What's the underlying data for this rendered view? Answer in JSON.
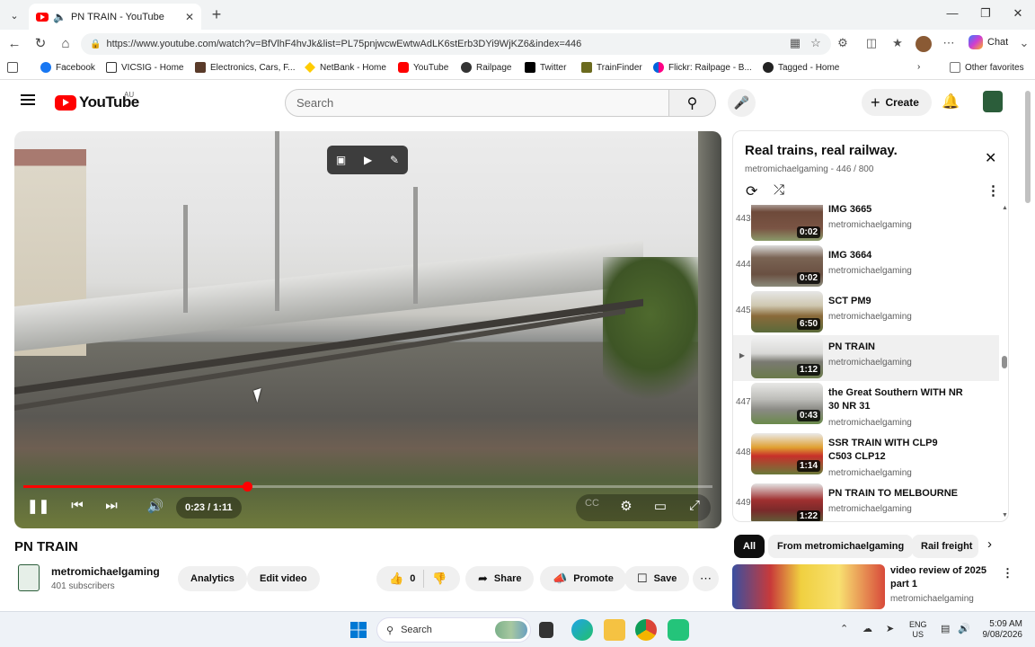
{
  "browser": {
    "tab_title": "PN TRAIN - YouTube",
    "url": "https://www.youtube.com/watch?v=BfVlhF4hvJk&list=PL75pnjwcwEwtwAdLK6stErb3DYi9WjKZ6&index=446",
    "chat_label": "Chat",
    "bookmarks": [
      "Facebook",
      "VICSIG - Home",
      "Electronics, Cars, F...",
      "NetBank - Home",
      "YouTube",
      "Railpage",
      "Twitter",
      "TrainFinder",
      "Flickr: Railpage - B...",
      "Tagged - Home"
    ],
    "other_favorites": "Other favorites"
  },
  "youtube": {
    "logo_text": "YouTube",
    "country_code": "AU",
    "search_placeholder": "Search",
    "create_label": "Create"
  },
  "player": {
    "current_time": "0:23",
    "duration": "1:11",
    "time_display": "0:23 / 1:11",
    "progress_fraction": 0.324
  },
  "video": {
    "title": "PN TRAIN",
    "channel": "metromichaelgaming",
    "subscribers": "401 subscribers",
    "analytics_label": "Analytics",
    "edit_label": "Edit video",
    "like_count": "0",
    "share_label": "Share",
    "promote_label": "Promote",
    "save_label": "Save"
  },
  "playlist": {
    "title": "Real trains, real railway.",
    "owner": "metromichaelgaming",
    "position": "446 / 800",
    "items": [
      {
        "index": "443",
        "title": "IMG 3665",
        "channel": "metromichaelgaming",
        "duration": "0:02"
      },
      {
        "index": "444",
        "title": "IMG 3664",
        "channel": "metromichaelgaming",
        "duration": "0:02"
      },
      {
        "index": "445",
        "title": "SCT PM9",
        "channel": "metromichaelgaming",
        "duration": "6:50"
      },
      {
        "index": "▶",
        "title": "PN TRAIN",
        "channel": "metromichaelgaming",
        "duration": "1:12"
      },
      {
        "index": "447",
        "title": "the Great Southern WITH NR 30 NR 31",
        "channel": "metromichaelgaming",
        "duration": "0:43"
      },
      {
        "index": "448",
        "title": "SSR TRAIN WITH CLP9 C503 CLP12",
        "channel": "metromichaelgaming",
        "duration": "1:14"
      },
      {
        "index": "449",
        "title": "PN TRAIN TO MELBOURNE",
        "channel": "metromichaelgaming",
        "duration": "1:22"
      }
    ]
  },
  "chips": [
    "All",
    "From metromichaelgaming",
    "Rail freight"
  ],
  "recommendation": {
    "title": "video review of 2025 part 1",
    "channel": "metromichaelgaming"
  },
  "taskbar": {
    "search_label": "Search",
    "lang_top": "ENG",
    "lang_bottom": "US",
    "time": "5:09 AM",
    "date": "9/08/2026"
  }
}
